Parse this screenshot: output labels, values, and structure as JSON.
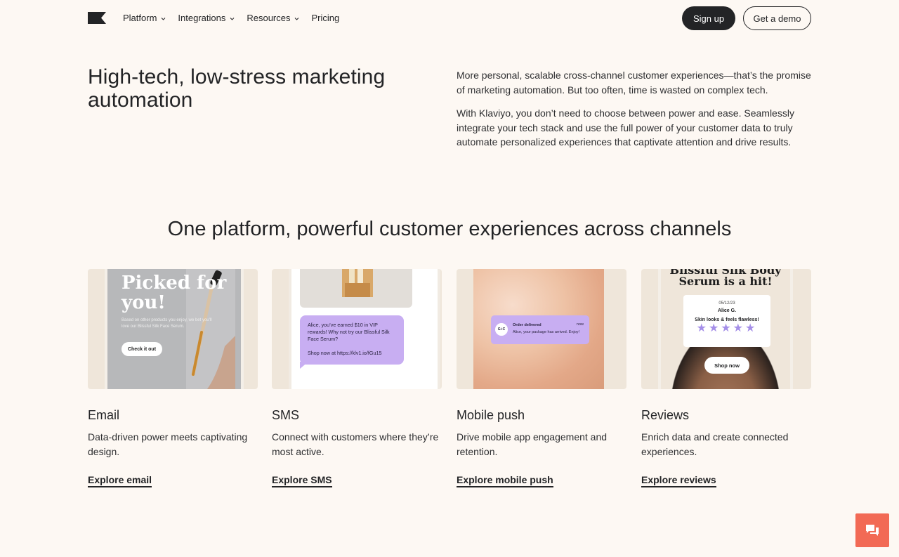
{
  "nav": {
    "links": [
      {
        "label": "Platform",
        "has_dropdown": true
      },
      {
        "label": "Integrations",
        "has_dropdown": true
      },
      {
        "label": "Resources",
        "has_dropdown": true
      },
      {
        "label": "Pricing",
        "has_dropdown": false
      }
    ],
    "signup_label": "Sign up",
    "demo_label": "Get a demo"
  },
  "hero": {
    "title": "High-tech, low-stress marketing automation",
    "paragraph1": "More personal, scalable cross-channel customer experiences—that’s the promise of marketing automation. But too often, time is wasted on complex tech.",
    "paragraph2": "With Klaviyo, you don’t need to choose between power and ease. Seamlessly integrate your tech stack and use the full power of your customer data to truly automate personalized experiences that captivate attention and drive results."
  },
  "channels": {
    "title": "One platform, powerful customer experiences across channels",
    "cards": [
      {
        "name": "Email",
        "description": "Data-driven power meets captivating design.",
        "link": "Explore email",
        "art": {
          "headline": "Picked for you!",
          "body": "Based on other products you enjoy, we bet you’ll love our Blissful Silk Face Serum.",
          "button": "Check it out"
        }
      },
      {
        "name": "SMS",
        "description": "Connect with customers where they’re most active.",
        "link": "Explore SMS",
        "art": {
          "message": "Alice, you’ve earned $10 in VIP rewards! Why not try our Blissful Silk Face Serum?",
          "link_text": "Shop now at https://klv1.io/fGu15"
        }
      },
      {
        "name": "Mobile push",
        "description": "Drive mobile app engagement and retention.",
        "link": "Explore mobile push",
        "art": {
          "avatar": "G+C",
          "title": "Order delivered",
          "time": "now",
          "body": "Alice, your package has arrived. Enjoy!"
        }
      },
      {
        "name": "Reviews",
        "description": "Enrich data and create connected experiences.",
        "link": "Explore reviews",
        "art": {
          "headline": "Blissful Silk Body Serum is a hit!",
          "date": "05/12/23",
          "reviewer": "Alice G.",
          "quote": "Skin looks & feels flawless!",
          "stars": "★★★★★",
          "button": "Shop now"
        }
      }
    ]
  },
  "colors": {
    "background": "#fdf8f3",
    "text": "#232426",
    "accent_purple": "#c8aef2",
    "chat_button": "#f26a55"
  },
  "icons": {
    "logo": "klaviyo-flag-logo",
    "chat": "chat-bubbles-icon",
    "chevron": "chevron-down-icon"
  }
}
